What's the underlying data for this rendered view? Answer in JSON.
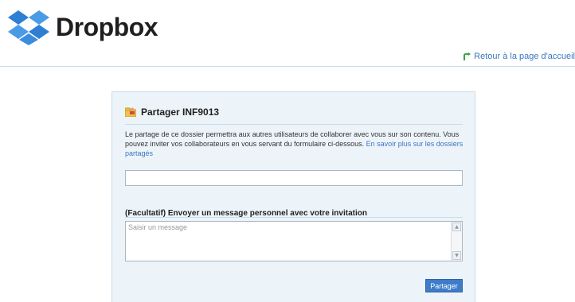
{
  "header": {
    "logo_text": "Dropbox",
    "back_link": "Retour à la page d'accueil",
    "logo_icon": "dropbox-box-icon",
    "back_icon": "return-arrow-icon"
  },
  "share_dialog": {
    "title": "Partager INF9013",
    "title_icon": "shared-folder-icon",
    "description": "Le partage de ce dossier permettra aux autres utilisateurs de collaborer avec vous sur son contenu. Vous pouvez inviter vos collaborateurs en vous servant du formulaire ci-dessous.",
    "learn_more_link": "En savoir plus sur les dossiers partagés",
    "invite_input_value": "",
    "optional_message_label": "(Facultatif) Envoyer un message personnel avec votre invitation",
    "message_placeholder": "Saisir un message",
    "share_button": "Partager"
  },
  "colors": {
    "link": "#3d76c0",
    "panel_bg": "#edf4f9",
    "panel_border": "#c9dbe8",
    "button_bg": "#3e7bc9"
  }
}
